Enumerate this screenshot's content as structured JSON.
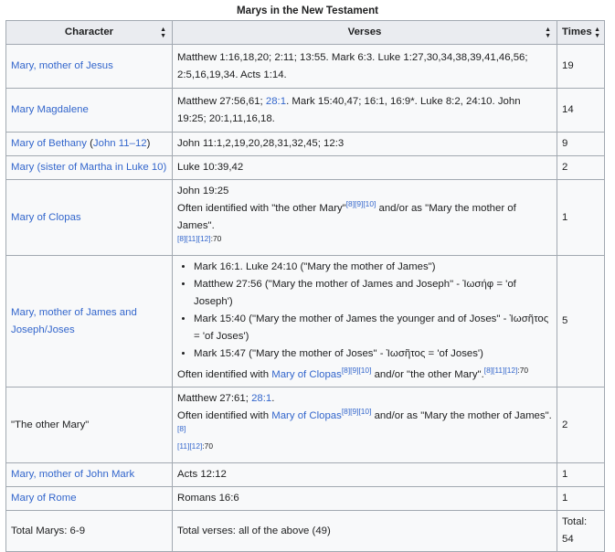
{
  "caption": "Marys in the New Testament",
  "headers": {
    "character": "Character",
    "verses": "Verses",
    "times": "Times"
  },
  "rows": {
    "r1": {
      "character": "Mary, mother of Jesus",
      "verses": "Matthew 1:16,18,20; 2:11; 13:55. Mark 6:3. Luke 1:27,30,34,38,39,41,46,56; 2:5,16,19,34. Acts 1:14.",
      "times": "19"
    },
    "r2": {
      "character": "Mary Magdalene",
      "verses_a": "Matthew 27:56,61;",
      "verses_link": "28:1",
      "verses_b": ". Mark 15:40,47; 16:1, 16:9*. Luke 8:2, 24:10. John 19:25; 20:1,11,16,18.",
      "times": "14"
    },
    "r3": {
      "character": "Mary of Bethany",
      "character_paren_open": " (",
      "character_link": "John 11–12",
      "character_paren_close": ")",
      "verses": "John 11:1,2,19,20,28,31,32,45; 12:3",
      "times": "9"
    },
    "r4": {
      "character": "Mary (sister of Martha in Luke 10)",
      "verses": "Luke 10:39,42",
      "times": "2"
    },
    "r5": {
      "character": "Mary of Clopas",
      "verses_line1": "John 19:25",
      "note_a": "Often identified with \"the other Mary\"",
      "refs_a": "[8][9][10]",
      "note_b": " and/or as \"Mary the mother of James\".",
      "refs_b": "[8][11][12]",
      "page": ":70",
      "times": "1"
    },
    "r6": {
      "character": "Mary, mother of James and Joseph/Joses",
      "bullets": [
        "Mark 16:1. Luke 24:10 (\"Mary the mother of James\")",
        "Matthew 27:56 (\"Mary the mother of James and Joseph\" - Ἰωσήφ = 'of Joseph')",
        "Mark 15:40 (\"Mary the mother of James the younger and of Joses\" - Ἰωσῆτος = 'of Joses')",
        "Mark 15:47 (\"Mary the mother of Joses\" - Ἰωσῆτος = 'of Joses')"
      ],
      "note_a": "Often identified with ",
      "note_link": "Mary of Clopas",
      "refs_a": "[8][9][10]",
      "note_b": " and/or \"the other Mary\".",
      "refs_b": "[8][11][12]",
      "page": ":70",
      "times": "5"
    },
    "r7": {
      "character": "\"The other Mary\"",
      "verses_a": "Matthew 27:61;",
      "verses_link": "28:1",
      "verses_b": ".",
      "note_a": "Often identified with ",
      "note_link": "Mary of Clopas",
      "refs_a": "[8][9][10]",
      "note_b": " and/or as \"Mary the mother of James\".",
      "refs_b": "[8]",
      "refs_c": "[11][12]",
      "page": ":70",
      "times": "2"
    },
    "r8": {
      "character": "Mary, mother of John Mark",
      "verses": "Acts 12:12",
      "times": "1"
    },
    "r9": {
      "character": "Mary of Rome",
      "verses": "Romans 16:6",
      "times": "1"
    },
    "total": {
      "character": "Total Marys: 6-9",
      "verses": "Total verses: all of the above (49)",
      "times": "Total: 54"
    }
  }
}
